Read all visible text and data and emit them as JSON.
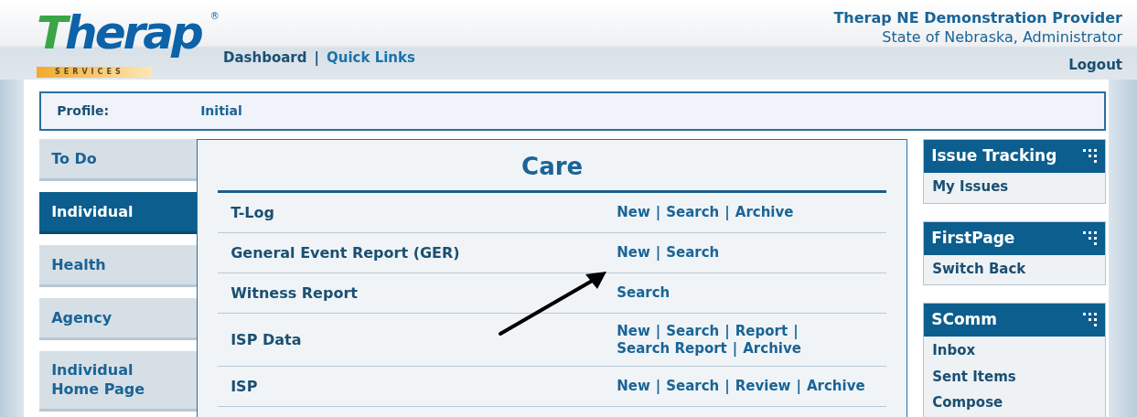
{
  "logo": {
    "text": "Therap",
    "mark": "®",
    "tagline": "SERVICES"
  },
  "header_nav": [
    {
      "kind": "link",
      "label": "Dashboard",
      "selected": true
    },
    {
      "kind": "separator",
      "label": "|"
    },
    {
      "kind": "link",
      "label": "Quick Links",
      "selected": false
    }
  ],
  "account": {
    "provider": "Therap NE Demonstration Provider",
    "user": "State of Nebraska, Administrator",
    "logout": "Logout"
  },
  "profile": {
    "label": "Profile:",
    "value": "Initial"
  },
  "sidebar": {
    "items": [
      {
        "label": "To Do",
        "selected": false
      },
      {
        "label": "Individual",
        "selected": true
      },
      {
        "label": "Health",
        "selected": false
      },
      {
        "label": "Agency",
        "selected": false
      },
      {
        "label": "Individual Home Page",
        "selected": false
      }
    ]
  },
  "panel": {
    "title": "Care",
    "rows": [
      {
        "name": "T-Log",
        "actions": [
          {
            "kind": "link",
            "label": "New"
          },
          {
            "kind": "separator",
            "label": "|"
          },
          {
            "kind": "link",
            "label": "Search"
          },
          {
            "kind": "separator",
            "label": "|"
          },
          {
            "kind": "link",
            "label": "Archive"
          }
        ]
      },
      {
        "name": "General Event Report (GER)",
        "actions": [
          {
            "kind": "link",
            "label": "New"
          },
          {
            "kind": "separator",
            "label": "|"
          },
          {
            "kind": "link",
            "label": "Search"
          }
        ]
      },
      {
        "name": "Witness Report",
        "actions": [
          {
            "kind": "link",
            "label": "Search"
          }
        ]
      },
      {
        "name": "ISP Data",
        "actions": [
          {
            "kind": "link",
            "label": "New"
          },
          {
            "kind": "separator",
            "label": "|"
          },
          {
            "kind": "link",
            "label": "Search"
          },
          {
            "kind": "separator",
            "label": "|"
          },
          {
            "kind": "link",
            "label": "Report"
          },
          {
            "kind": "separator",
            "label": "|"
          },
          {
            "kind": "break"
          },
          {
            "kind": "link",
            "label": "Search Report"
          },
          {
            "kind": "separator",
            "label": "|"
          },
          {
            "kind": "link",
            "label": "Archive"
          }
        ]
      },
      {
        "name": "ISP",
        "actions": [
          {
            "kind": "link",
            "label": "New"
          },
          {
            "kind": "separator",
            "label": "|"
          },
          {
            "kind": "link",
            "label": "Search"
          },
          {
            "kind": "separator",
            "label": "|"
          },
          {
            "kind": "link",
            "label": "Review"
          },
          {
            "kind": "separator",
            "label": "|"
          },
          {
            "kind": "link",
            "label": "Archive"
          }
        ]
      }
    ]
  },
  "widgets": [
    {
      "title": "Issue Tracking",
      "links": [
        "My Issues"
      ]
    },
    {
      "title": "FirstPage",
      "links": [
        "Switch Back"
      ]
    },
    {
      "title": "SComm",
      "links": [
        "Inbox",
        "Sent Items",
        "Compose"
      ]
    }
  ]
}
